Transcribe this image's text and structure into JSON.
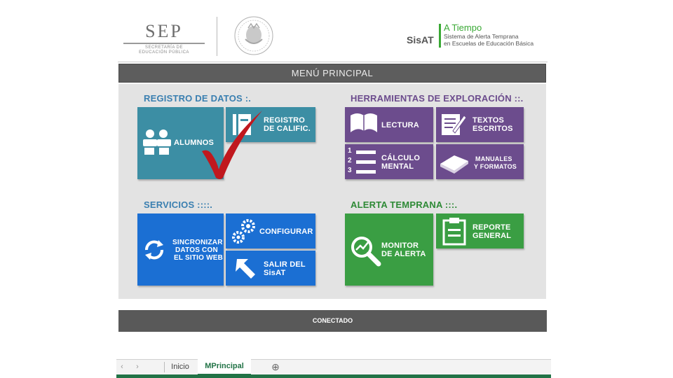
{
  "header": {
    "sep_logo": "SEP",
    "sep_subtitle_line1": "SECRETARÍA DE",
    "sep_subtitle_line2": "EDUCACIÓN PÚBLICA",
    "sisat_label": "SisAT",
    "atiempo_title": "A Tiempo",
    "atiempo_line1": "Sistema de Alerta Temprana",
    "atiempo_line2": "en Escuelas de Educación Básica"
  },
  "menu_title": "MENÚ PRINCIPAL",
  "sections": {
    "registro": "REGISTRO DE DATOS :.",
    "herramientas": "HERRAMIENTAS DE EXPLORACIÓN ::.",
    "servicios": "SERVICIOS ::::.",
    "alerta": "ALERTA TEMPRANA :::."
  },
  "tiles": {
    "alumnos": "ALUMNOS",
    "registro_calific_1": "REGISTRO",
    "registro_calific_2": "DE CALIFIC.",
    "lectura": "LECTURA",
    "textos_1": "TEXTOS",
    "textos_2": "ESCRITOS",
    "calculo_1": "CÁLCULO",
    "calculo_2": "MENTAL",
    "calculo_n1": "1",
    "calculo_n2": "2",
    "calculo_n3": "3",
    "manuales_1": "MANUALES",
    "manuales_2": "Y FORMATOS",
    "sincronizar_1": "SINCRONIZAR",
    "sincronizar_2": "DATOS CON",
    "sincronizar_3": "EL SITIO WEB",
    "configurar": "CONFIGURAR",
    "salir_1": "SALIR DEL",
    "salir_2": "SisAT",
    "monitor_1": "MONITOR",
    "monitor_2": "DE ALERTA",
    "reporte_1": "REPORTE",
    "reporte_2": "GENERAL"
  },
  "status": "CONECTADO",
  "sheet_tabs": [
    "Inicio",
    "MPrincipal"
  ],
  "active_tab": "MPrincipal",
  "colors": {
    "teal": "#3c8ea4",
    "purple": "#6c4c8d",
    "blue": "#1b6fd3",
    "green": "#3a9e43",
    "checkmark": "#c0181e"
  }
}
